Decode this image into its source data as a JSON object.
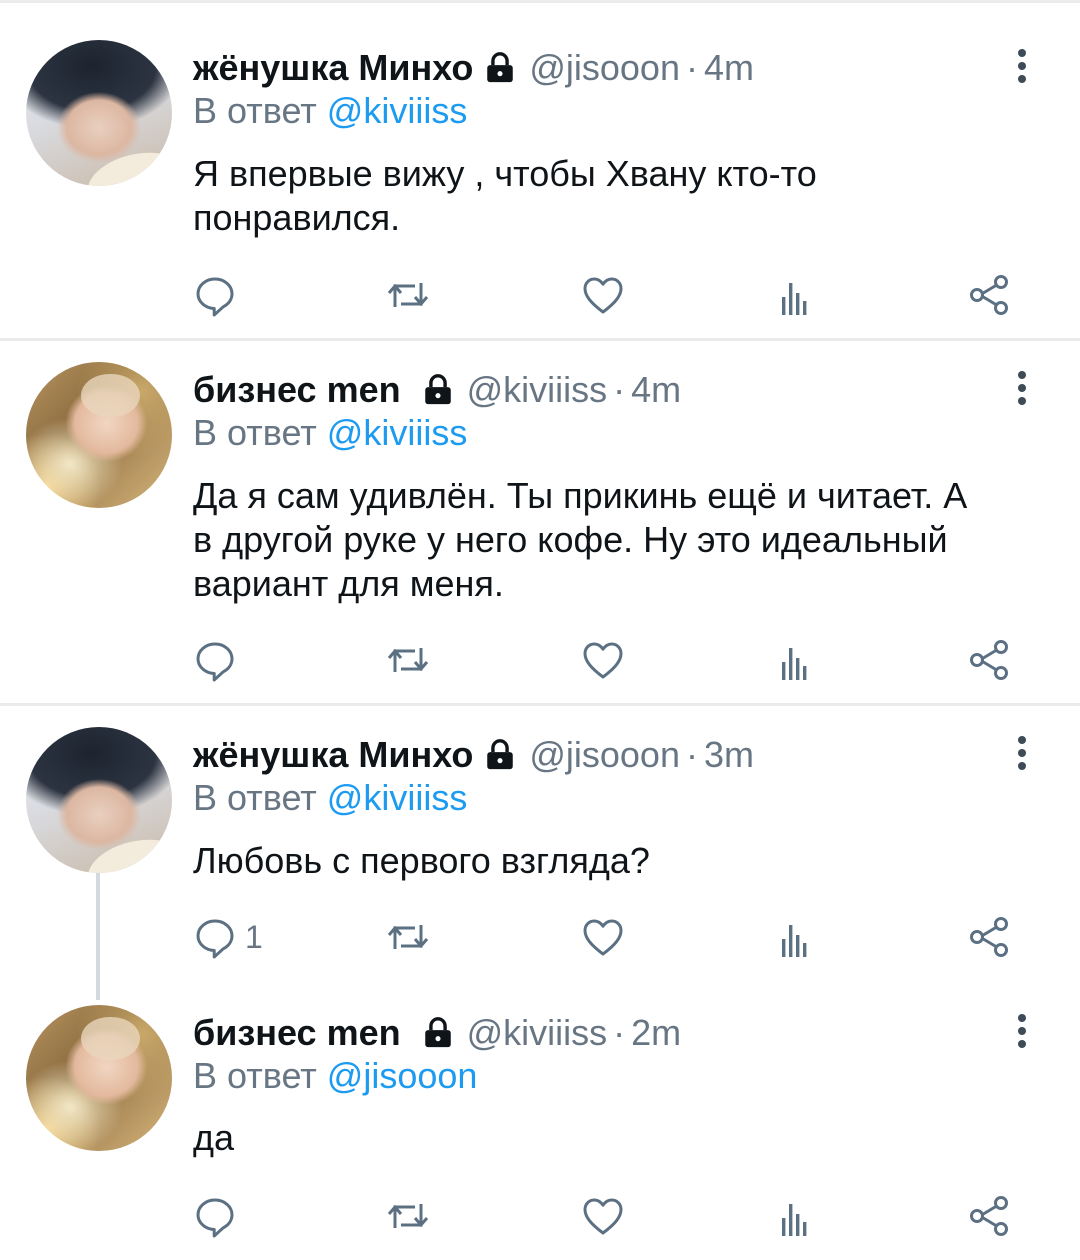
{
  "reply_prefix": "В ответ",
  "tweets": [
    {
      "name": "жёнушка Минхо",
      "handle": "@jisooon",
      "time": "4m",
      "reply_to": "@kiviiiss",
      "text_lines": [
        "Я впервые вижу , чтобы Хвану кто-то",
        "понравился."
      ],
      "reply_count": ""
    },
    {
      "name": "бизнес men",
      "handle": "@kiviiiss",
      "time": "4m",
      "reply_to": "@kiviiiss",
      "text_lines": [
        "Да я сам удивлён. Ты прикинь ещё и читает. А",
        "в другой руке у него кофе. Ну это идеальный",
        "вариант для меня."
      ],
      "reply_count": ""
    },
    {
      "name": "жёнушка Минхо",
      "handle": "@jisooon",
      "time": "3m",
      "reply_to": "@kiviiiss",
      "text_lines": [
        "Любовь с первого взгляда?"
      ],
      "reply_count": "1"
    },
    {
      "name": "бизнес men",
      "handle": "@kiviiiss",
      "time": "2m",
      "reply_to": "@jisooon",
      "text_lines": [
        "да"
      ],
      "reply_count": ""
    }
  ],
  "colors": {
    "accent": "#1d9bf0",
    "secondary_text": "#687684",
    "divider": "#e9ebed",
    "icon": "#5b7083"
  },
  "icons": [
    "lock-icon",
    "more-icon",
    "reply-icon",
    "retweet-icon",
    "like-icon",
    "stats-icon",
    "share-icon"
  ]
}
